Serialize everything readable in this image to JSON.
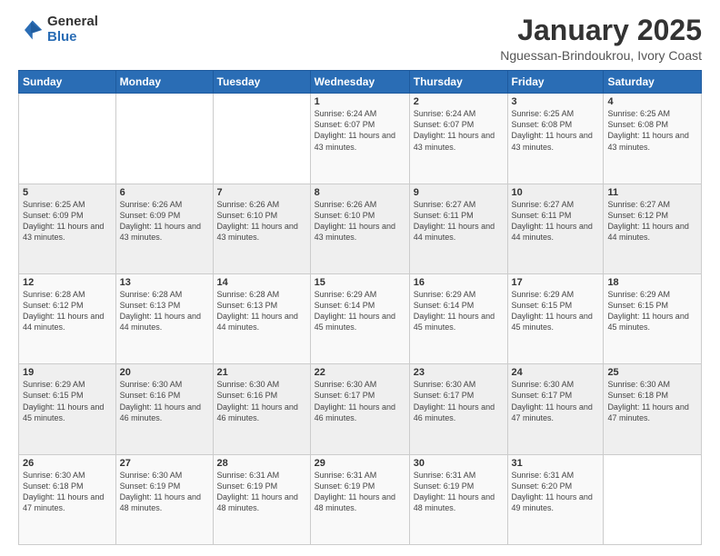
{
  "header": {
    "logo_general": "General",
    "logo_blue": "Blue",
    "month_title": "January 2025",
    "location": "Nguessan-Brindoukrou, Ivory Coast"
  },
  "weekdays": [
    "Sunday",
    "Monday",
    "Tuesday",
    "Wednesday",
    "Thursday",
    "Friday",
    "Saturday"
  ],
  "weeks": [
    [
      {
        "day": "",
        "info": ""
      },
      {
        "day": "",
        "info": ""
      },
      {
        "day": "",
        "info": ""
      },
      {
        "day": "1",
        "info": "Sunrise: 6:24 AM\nSunset: 6:07 PM\nDaylight: 11 hours and 43 minutes."
      },
      {
        "day": "2",
        "info": "Sunrise: 6:24 AM\nSunset: 6:07 PM\nDaylight: 11 hours and 43 minutes."
      },
      {
        "day": "3",
        "info": "Sunrise: 6:25 AM\nSunset: 6:08 PM\nDaylight: 11 hours and 43 minutes."
      },
      {
        "day": "4",
        "info": "Sunrise: 6:25 AM\nSunset: 6:08 PM\nDaylight: 11 hours and 43 minutes."
      }
    ],
    [
      {
        "day": "5",
        "info": "Sunrise: 6:25 AM\nSunset: 6:09 PM\nDaylight: 11 hours and 43 minutes."
      },
      {
        "day": "6",
        "info": "Sunrise: 6:26 AM\nSunset: 6:09 PM\nDaylight: 11 hours and 43 minutes."
      },
      {
        "day": "7",
        "info": "Sunrise: 6:26 AM\nSunset: 6:10 PM\nDaylight: 11 hours and 43 minutes."
      },
      {
        "day": "8",
        "info": "Sunrise: 6:26 AM\nSunset: 6:10 PM\nDaylight: 11 hours and 43 minutes."
      },
      {
        "day": "9",
        "info": "Sunrise: 6:27 AM\nSunset: 6:11 PM\nDaylight: 11 hours and 44 minutes."
      },
      {
        "day": "10",
        "info": "Sunrise: 6:27 AM\nSunset: 6:11 PM\nDaylight: 11 hours and 44 minutes."
      },
      {
        "day": "11",
        "info": "Sunrise: 6:27 AM\nSunset: 6:12 PM\nDaylight: 11 hours and 44 minutes."
      }
    ],
    [
      {
        "day": "12",
        "info": "Sunrise: 6:28 AM\nSunset: 6:12 PM\nDaylight: 11 hours and 44 minutes."
      },
      {
        "day": "13",
        "info": "Sunrise: 6:28 AM\nSunset: 6:13 PM\nDaylight: 11 hours and 44 minutes."
      },
      {
        "day": "14",
        "info": "Sunrise: 6:28 AM\nSunset: 6:13 PM\nDaylight: 11 hours and 44 minutes."
      },
      {
        "day": "15",
        "info": "Sunrise: 6:29 AM\nSunset: 6:14 PM\nDaylight: 11 hours and 45 minutes."
      },
      {
        "day": "16",
        "info": "Sunrise: 6:29 AM\nSunset: 6:14 PM\nDaylight: 11 hours and 45 minutes."
      },
      {
        "day": "17",
        "info": "Sunrise: 6:29 AM\nSunset: 6:15 PM\nDaylight: 11 hours and 45 minutes."
      },
      {
        "day": "18",
        "info": "Sunrise: 6:29 AM\nSunset: 6:15 PM\nDaylight: 11 hours and 45 minutes."
      }
    ],
    [
      {
        "day": "19",
        "info": "Sunrise: 6:29 AM\nSunset: 6:15 PM\nDaylight: 11 hours and 45 minutes."
      },
      {
        "day": "20",
        "info": "Sunrise: 6:30 AM\nSunset: 6:16 PM\nDaylight: 11 hours and 46 minutes."
      },
      {
        "day": "21",
        "info": "Sunrise: 6:30 AM\nSunset: 6:16 PM\nDaylight: 11 hours and 46 minutes."
      },
      {
        "day": "22",
        "info": "Sunrise: 6:30 AM\nSunset: 6:17 PM\nDaylight: 11 hours and 46 minutes."
      },
      {
        "day": "23",
        "info": "Sunrise: 6:30 AM\nSunset: 6:17 PM\nDaylight: 11 hours and 46 minutes."
      },
      {
        "day": "24",
        "info": "Sunrise: 6:30 AM\nSunset: 6:17 PM\nDaylight: 11 hours and 47 minutes."
      },
      {
        "day": "25",
        "info": "Sunrise: 6:30 AM\nSunset: 6:18 PM\nDaylight: 11 hours and 47 minutes."
      }
    ],
    [
      {
        "day": "26",
        "info": "Sunrise: 6:30 AM\nSunset: 6:18 PM\nDaylight: 11 hours and 47 minutes."
      },
      {
        "day": "27",
        "info": "Sunrise: 6:30 AM\nSunset: 6:19 PM\nDaylight: 11 hours and 48 minutes."
      },
      {
        "day": "28",
        "info": "Sunrise: 6:31 AM\nSunset: 6:19 PM\nDaylight: 11 hours and 48 minutes."
      },
      {
        "day": "29",
        "info": "Sunrise: 6:31 AM\nSunset: 6:19 PM\nDaylight: 11 hours and 48 minutes."
      },
      {
        "day": "30",
        "info": "Sunrise: 6:31 AM\nSunset: 6:19 PM\nDaylight: 11 hours and 48 minutes."
      },
      {
        "day": "31",
        "info": "Sunrise: 6:31 AM\nSunset: 6:20 PM\nDaylight: 11 hours and 49 minutes."
      },
      {
        "day": "",
        "info": ""
      }
    ]
  ]
}
